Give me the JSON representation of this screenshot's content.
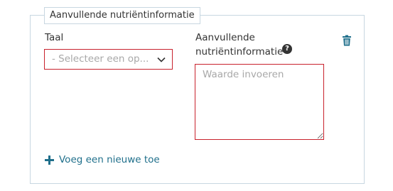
{
  "section": {
    "legend": "Aanvullende nutriëntinformatie"
  },
  "language_field": {
    "label": "Taal",
    "selected_value": "- Selecteer een op...",
    "icon": "chevron-down-icon"
  },
  "info_field": {
    "label_line1": "Aanvullende",
    "label_line2": "nutriëntinformatie",
    "help_glyph": "?",
    "placeholder": "Waarde invoeren",
    "value": ""
  },
  "actions": {
    "delete_icon": "trash-icon",
    "add_new_label": "Voeg een nieuwe toe",
    "add_icon": "plus-icon"
  },
  "colors": {
    "error_border": "#c8222d",
    "link": "#1f6f8b",
    "fieldset_border": "#c8d7e1",
    "placeholder_text": "#a8a8a8",
    "label_text": "#333333"
  }
}
